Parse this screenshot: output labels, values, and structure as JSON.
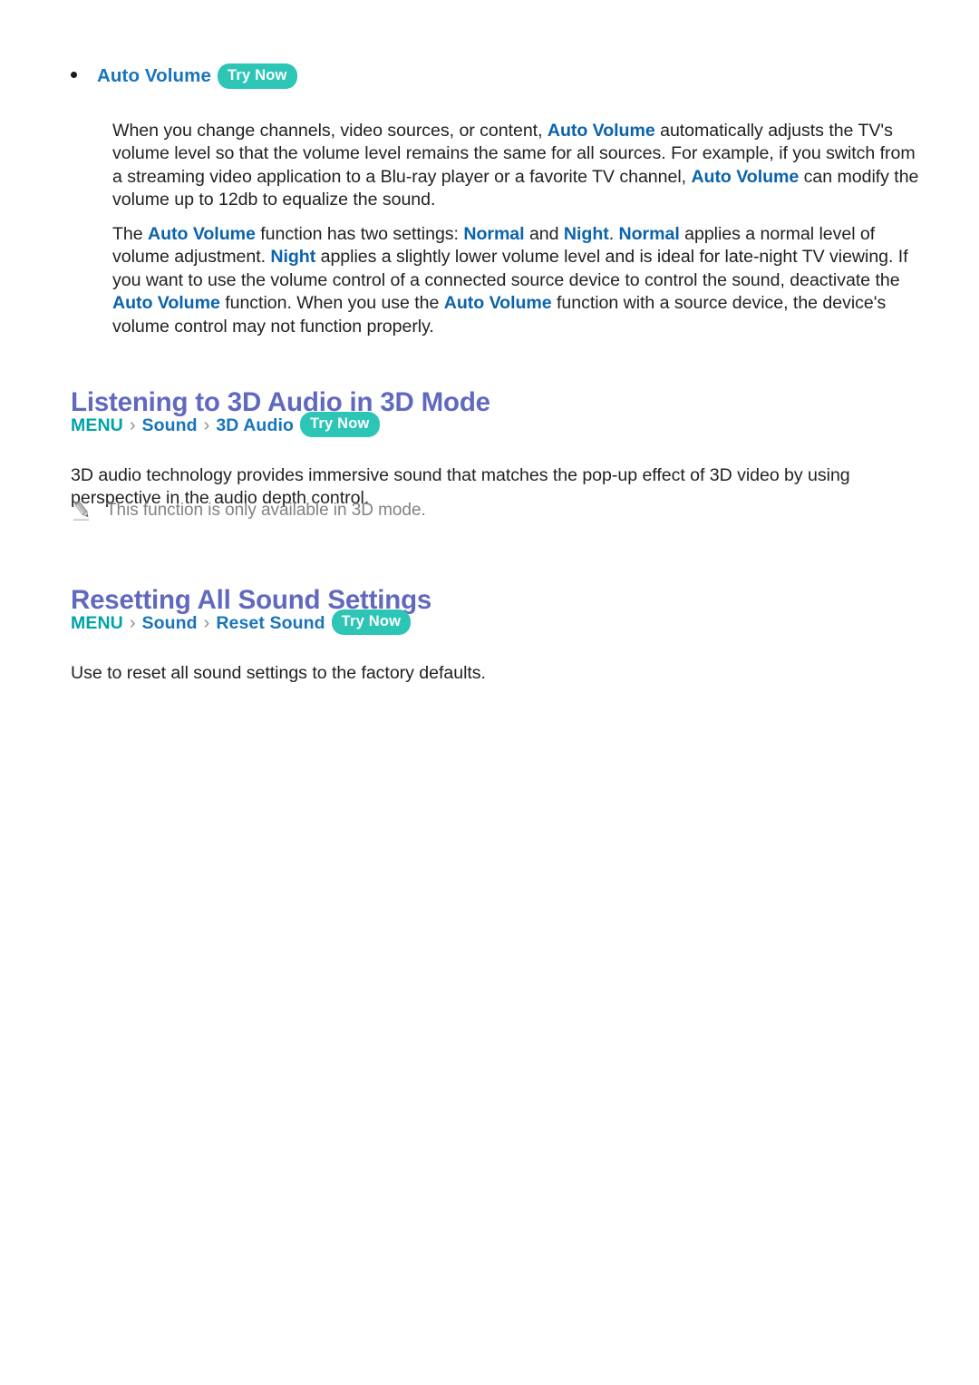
{
  "badge": {
    "try_now_label": "Try Now",
    "color": "#2cc5b6"
  },
  "colors": {
    "heading": "#6169bf",
    "link_blue": "#0b63ab",
    "bullet_blue": "#1874bd",
    "menu_teal": "#00a3a8",
    "note_gray": "#808285",
    "body": "#231f20"
  },
  "auto_volume_section": {
    "bullet_label": "Auto Volume",
    "paragraph_1": {
      "segment_1": "When you change channels, video sources, or content, ",
      "link_1": "Auto Volume",
      "segment_2": " automatically adjusts the TV's volume level so that the volume level remains the same for all sources. For example, if you switch from a streaming video application to a Blu-ray player or a favorite TV channel, ",
      "link_2": "Auto Volume",
      "segment_3": " can modify the volume up to 12db to equalize the sound."
    },
    "paragraph_2": {
      "segment_1": "The ",
      "link_1": "Auto Volume",
      "segment_2": " function has two settings: ",
      "link_2": "Normal",
      "segment_3": " and ",
      "link_3": "Night",
      "segment_4": ". ",
      "link_4": "Normal",
      "segment_5": " applies a normal level of volume adjustment. ",
      "link_5": "Night",
      "segment_6": " applies a slightly lower volume level and is ideal for late-night TV viewing. If you want to use the volume control of a connected source device to control the sound, deactivate the ",
      "link_6": "Auto Volume",
      "segment_7": " function. When you use the ",
      "link_7": "Auto Volume",
      "segment_8": " function with a source device, the device's volume control may not function properly."
    }
  },
  "audio_3d_section": {
    "heading": "Listening to 3D Audio in 3D Mode",
    "breadcrumb": {
      "menu": "MENU",
      "separator": "›",
      "item_1": "Sound",
      "item_2": "3D Audio"
    },
    "body": "3D audio technology provides immersive sound that matches the pop-up effect of 3D video by using perspective in the audio depth control.",
    "note": "This function is only available in 3D mode."
  },
  "reset_sound_section": {
    "heading": "Resetting All Sound Settings",
    "breadcrumb": {
      "menu": "MENU",
      "separator": "›",
      "item_1": "Sound",
      "item_2": "Reset Sound"
    },
    "body": "Use to reset all sound settings to the factory defaults."
  }
}
